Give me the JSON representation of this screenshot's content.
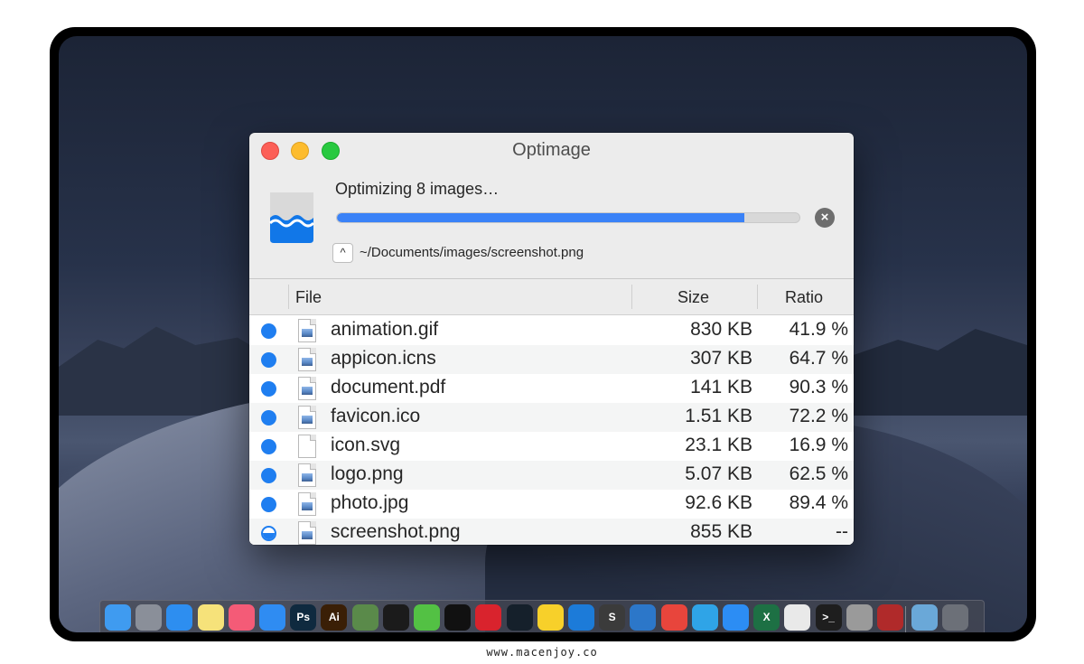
{
  "window": {
    "title": "Optimage"
  },
  "progress": {
    "status_text": "Optimizing 8 images…",
    "fraction": 0.88,
    "current_path": "~/Documents/images/screenshot.png",
    "stop_glyph": "×",
    "disclose_glyph": "^"
  },
  "table": {
    "headers": {
      "file": "File",
      "size": "Size",
      "ratio": "Ratio"
    },
    "rows": [
      {
        "name": "animation.gif",
        "size": "830 KB",
        "ratio": "41.9 %",
        "status": "done",
        "icon": "image-file-icon"
      },
      {
        "name": "appicon.icns",
        "size": "307 KB",
        "ratio": "64.7 %",
        "status": "done",
        "icon": "image-file-icon"
      },
      {
        "name": "document.pdf",
        "size": "141 KB",
        "ratio": "90.3 %",
        "status": "done",
        "icon": "image-file-icon"
      },
      {
        "name": "favicon.ico",
        "size": "1.51 KB",
        "ratio": "72.2 %",
        "status": "done",
        "icon": "image-file-icon"
      },
      {
        "name": "icon.svg",
        "size": "23.1 KB",
        "ratio": "16.9 %",
        "status": "done",
        "icon": "blank-file-icon"
      },
      {
        "name": "logo.png",
        "size": "5.07 KB",
        "ratio": "62.5 %",
        "status": "done",
        "icon": "image-file-icon"
      },
      {
        "name": "photo.jpg",
        "size": "92.6 KB",
        "ratio": "89.4 %",
        "status": "done",
        "icon": "image-file-icon"
      },
      {
        "name": "screenshot.png",
        "size": "855 KB",
        "ratio": "--",
        "status": "in-progress",
        "icon": "image-file-icon"
      }
    ]
  },
  "colors": {
    "accent": "#3a82f7",
    "status_dot": "#1f7ef0"
  },
  "dock": {
    "items": [
      {
        "name": "finder-icon",
        "color": "#3f9bf0",
        "glyph": ""
      },
      {
        "name": "launchpad-icon",
        "color": "#8a8f99",
        "glyph": ""
      },
      {
        "name": "safari-icon",
        "color": "#2d8ef0",
        "glyph": ""
      },
      {
        "name": "notes-icon",
        "color": "#f6e27a",
        "glyph": ""
      },
      {
        "name": "music-icon",
        "color": "#f45b77",
        "glyph": ""
      },
      {
        "name": "app-store-icon",
        "color": "#2f8cf2",
        "glyph": ""
      },
      {
        "name": "photoshop-icon",
        "color": "#0f2a3f",
        "glyph": "Ps"
      },
      {
        "name": "illustrator-icon",
        "color": "#3a1f06",
        "glyph": "Ai"
      },
      {
        "name": "archive-icon",
        "color": "#5a8a4a",
        "glyph": ""
      },
      {
        "name": "qq-icon",
        "color": "#1b1b1b",
        "glyph": ""
      },
      {
        "name": "wechat-icon",
        "color": "#53c144",
        "glyph": ""
      },
      {
        "name": "enjoy-icon",
        "color": "#111111",
        "glyph": ""
      },
      {
        "name": "netease-music-icon",
        "color": "#d9232d",
        "glyph": ""
      },
      {
        "name": "media-player-icon",
        "color": "#15202b",
        "glyph": ""
      },
      {
        "name": "qq-music-icon",
        "color": "#f7d02a",
        "glyph": ""
      },
      {
        "name": "teamviewer-icon",
        "color": "#1c7bd9",
        "glyph": ""
      },
      {
        "name": "sublime-text-icon",
        "color": "#3b3b3b",
        "glyph": "S"
      },
      {
        "name": "ftp-client-icon",
        "color": "#2c77c9",
        "glyph": ""
      },
      {
        "name": "chrome-icon",
        "color": "#e8453c",
        "glyph": ""
      },
      {
        "name": "migration-icon",
        "color": "#2fa4e7",
        "glyph": ""
      },
      {
        "name": "cloud-icon",
        "color": "#2c8df4",
        "glyph": ""
      },
      {
        "name": "excel-icon",
        "color": "#1d7044",
        "glyph": "X"
      },
      {
        "name": "text-editor-icon",
        "color": "#e9e9e9",
        "glyph": ""
      },
      {
        "name": "terminal-icon",
        "color": "#1e1e1e",
        "glyph": ">_"
      },
      {
        "name": "optimage-dock-icon",
        "color": "#9a9a9a",
        "glyph": ""
      },
      {
        "name": "photo-booth-icon",
        "color": "#b02a2a",
        "glyph": ""
      },
      {
        "name": "downloads-folder-icon",
        "color": "#6aa8d8",
        "glyph": ""
      },
      {
        "name": "trash-icon",
        "color": "#6c7078",
        "glyph": ""
      }
    ]
  },
  "footer": {
    "text": "www.macenjoy.co"
  }
}
